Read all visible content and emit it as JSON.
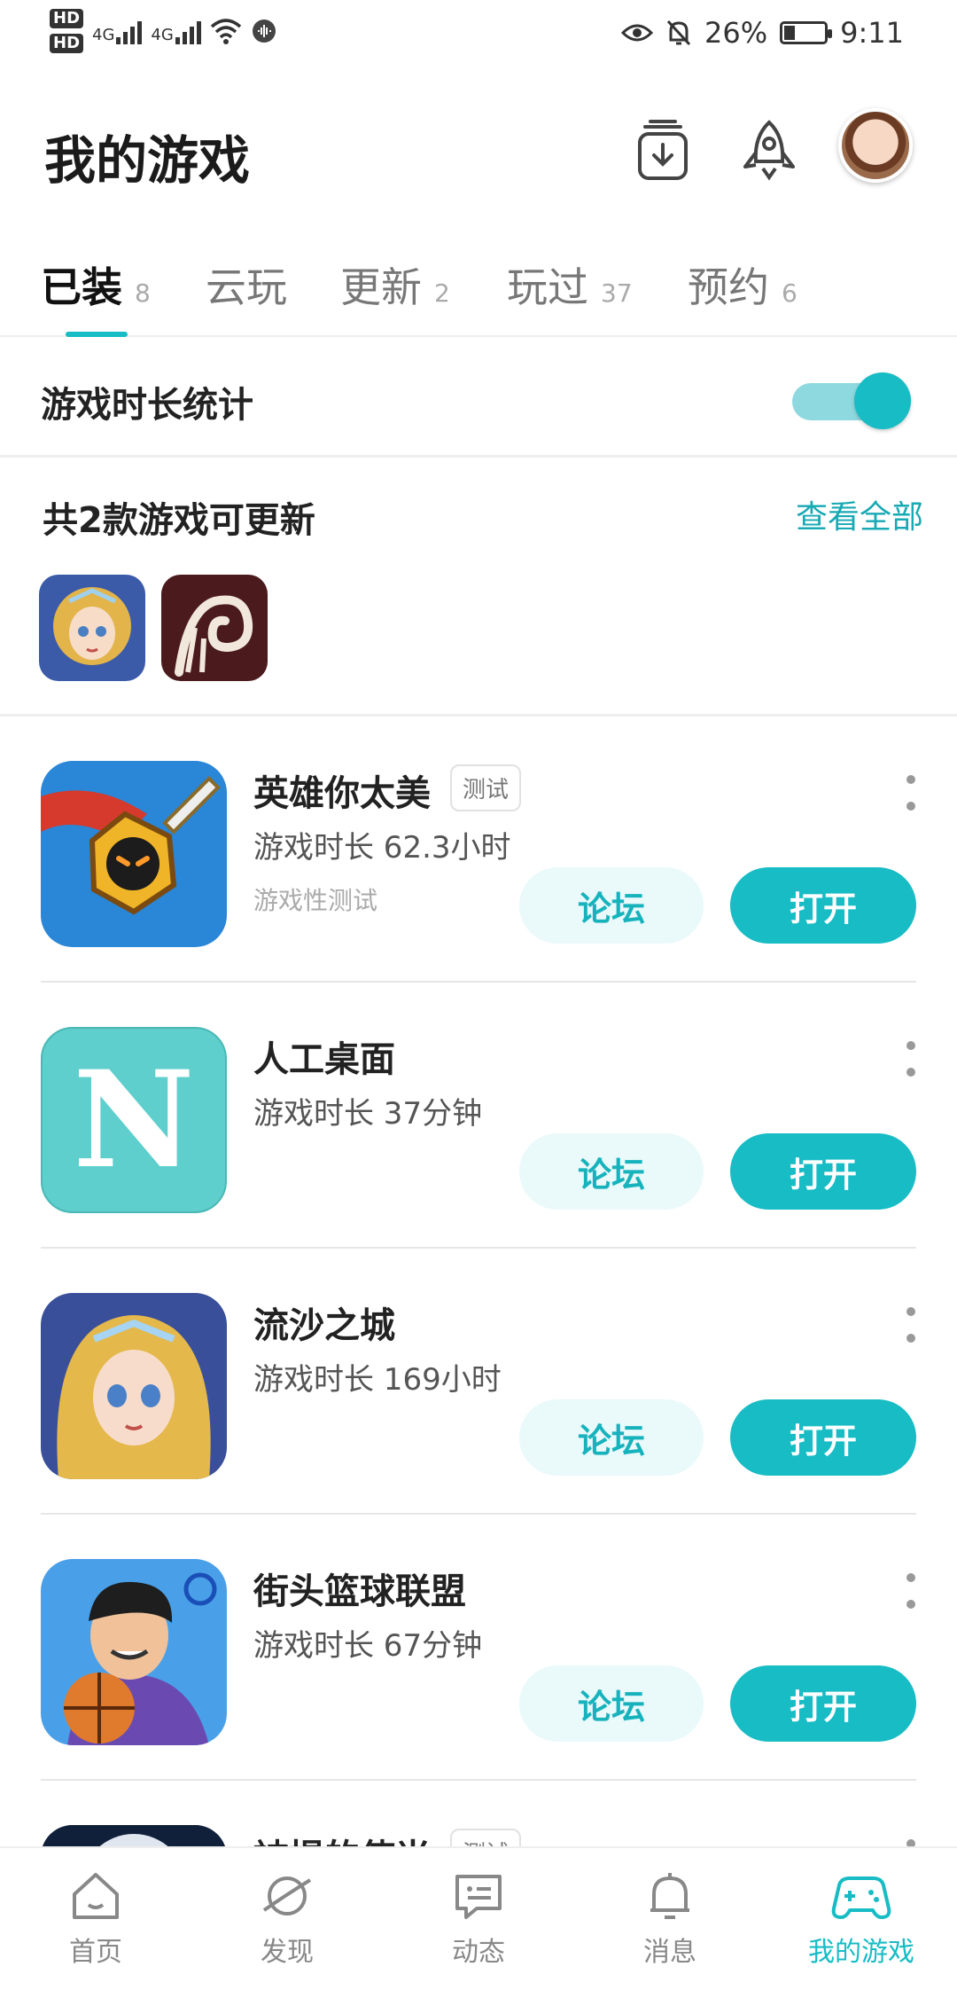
{
  "status_bar": {
    "hd1": "HD",
    "hd2": "HD",
    "net1": "4G",
    "net2": "4G",
    "battery_pct": "26%",
    "time": "9:11"
  },
  "header": {
    "title": "我的游戏",
    "icons": [
      "download-box-icon",
      "rocket-icon"
    ]
  },
  "tabs": [
    {
      "label": "已装",
      "count": "8",
      "active": true
    },
    {
      "label": "云玩",
      "count": ""
    },
    {
      "label": "更新",
      "count": "2"
    },
    {
      "label": "玩过",
      "count": "37"
    },
    {
      "label": "预约",
      "count": "6"
    }
  ],
  "playtime_stats": {
    "label": "游戏时长统计",
    "enabled": true
  },
  "updates": {
    "title": "共2款游戏可更新",
    "view_all": "查看全部"
  },
  "games": [
    {
      "name": "英雄你太美",
      "badge": "测试",
      "playtime": "游戏时长 62.3小时",
      "note": "游戏性测试",
      "forum": "论坛",
      "open": "打开"
    },
    {
      "name": "人工桌面",
      "playtime": "游戏时长 37分钟",
      "forum": "论坛",
      "open": "打开",
      "icon_letter": "N"
    },
    {
      "name": "流沙之城",
      "playtime": "游戏时长 169小时",
      "forum": "论坛",
      "open": "打开"
    },
    {
      "name": "街头篮球联盟",
      "playtime": "游戏时长 67分钟",
      "forum": "论坛",
      "open": "打开"
    },
    {
      "name": "被提的使当",
      "badge": "测试"
    }
  ],
  "bottom_nav": [
    {
      "label": "首页",
      "icon": "home-icon"
    },
    {
      "label": "发现",
      "icon": "planet-icon"
    },
    {
      "label": "动态",
      "icon": "chat-icon"
    },
    {
      "label": "消息",
      "icon": "bell-icon"
    },
    {
      "label": "我的游戏",
      "icon": "gamepad-icon",
      "active": true
    }
  ],
  "colors": {
    "accent": "#17bcc5",
    "accent_light": "#eaf9fa"
  }
}
